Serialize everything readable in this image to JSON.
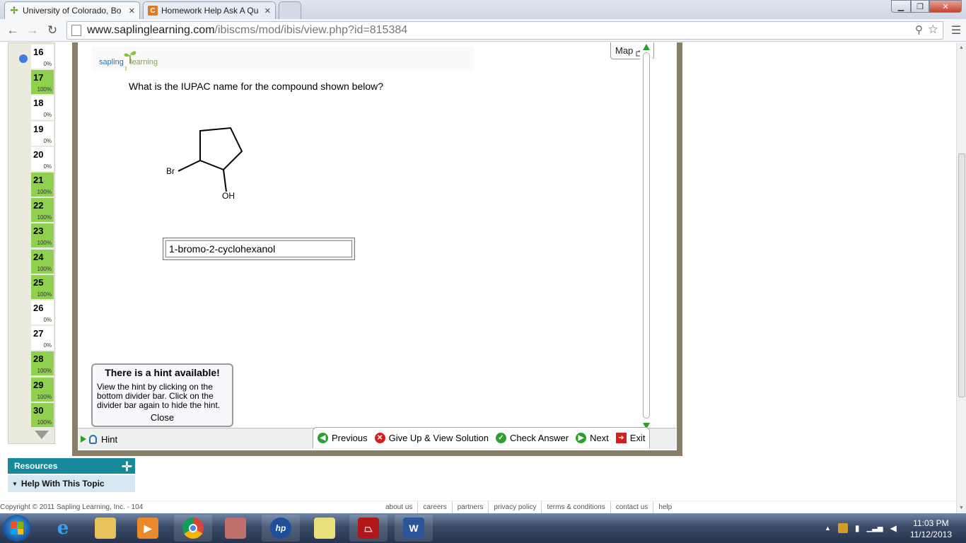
{
  "browser": {
    "tabs": [
      {
        "title": "University of Colorado, Bo",
        "active": true
      },
      {
        "title": "Homework Help Ask A Qu",
        "active": false
      }
    ],
    "url_host": "www.saplinglearning.com",
    "url_path": "/ibiscms/mod/ibis/view.php?id=815384"
  },
  "questions": [
    {
      "number": "16",
      "percent": "0%",
      "complete": false,
      "current": true
    },
    {
      "number": "17",
      "percent": "100%",
      "complete": true
    },
    {
      "number": "18",
      "percent": "0%",
      "complete": false
    },
    {
      "number": "19",
      "percent": "0%",
      "complete": false
    },
    {
      "number": "20",
      "percent": "0%",
      "complete": false
    },
    {
      "number": "21",
      "percent": "100%",
      "complete": true
    },
    {
      "number": "22",
      "percent": "100%",
      "complete": true
    },
    {
      "number": "23",
      "percent": "100%",
      "complete": true
    },
    {
      "number": "24",
      "percent": "100%",
      "complete": true
    },
    {
      "number": "25",
      "percent": "100%",
      "complete": true
    },
    {
      "number": "26",
      "percent": "0%",
      "complete": false
    },
    {
      "number": "27",
      "percent": "0%",
      "complete": false
    },
    {
      "number": "28",
      "percent": "100%",
      "complete": true
    },
    {
      "number": "29",
      "percent": "100%",
      "complete": true
    },
    {
      "number": "30",
      "percent": "100%",
      "complete": true
    }
  ],
  "logo": {
    "part1": "sapling",
    "part2": "learning"
  },
  "map_label": "Map",
  "question_text": "What is the IUPAC name for the compound shown below?",
  "molecule": {
    "label_br": "Br",
    "label_oh": "OH"
  },
  "answer_value": "1-bromo-2-cyclohexanol",
  "hint_popup": {
    "heading": "There is a hint available!",
    "body": "View the hint by clicking on the bottom divider bar. Click on the divider bar again to hide the hint.",
    "close": "Close"
  },
  "bottom": {
    "hint": "Hint",
    "previous": "Previous",
    "give_up": "Give Up & View Solution",
    "check": "Check Answer",
    "next": "Next",
    "exit": "Exit"
  },
  "resources": {
    "title": "Resources",
    "help_topic": "Help With This Topic"
  },
  "footer": {
    "copyright": "Copyright © 2011 Sapling Learning, Inc. - 104",
    "links": [
      "about us",
      "careers",
      "partners",
      "privacy policy",
      "terms & conditions",
      "contact us",
      "help"
    ]
  },
  "clock": {
    "time": "11:03 PM",
    "date": "11/12/2013"
  },
  "colors": {
    "complete": "#8fd14f",
    "resources": "#168a9a",
    "frame": "#8a7f66",
    "action_green": "#2ca02c",
    "action_red": "#d42020"
  }
}
